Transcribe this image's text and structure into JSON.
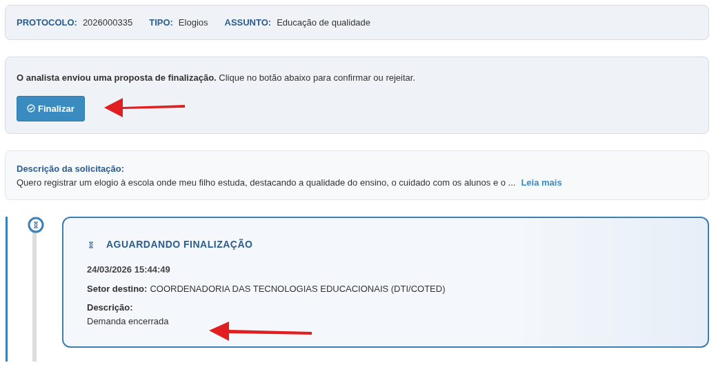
{
  "header_fields": [
    {
      "label": "PROTOCOLO:",
      "value": "2026000335"
    },
    {
      "label": "TIPO:",
      "value": "Elogios"
    },
    {
      "label": "ASSUNTO:",
      "value": "Educação de qualidade"
    }
  ],
  "proposal": {
    "message": "**O analista enviou uma proposta de finalização.** Clique no botão abaixo para confirmar ou rejeitar.",
    "button": "Finalizar"
  },
  "request": {
    "title": "Descrição da solicitação:",
    "text": "Quero registrar um elogio à escola onde meu filho estuda, destacando a qualidade do ensino, o cuidado com os alunos e o ...",
    "link": "Leia mais"
  },
  "timeline": [
    {
      "status": "AGUARDANDO FINALIZAÇÃO",
      "datetime": "24/03/2026 15:44:49",
      "sector_label": "Setor destino:",
      "sector": "COORDENADORIA DAS TECNOLOGIAS EDUCACIONAIS (DTI/COTED)",
      "description_label": "Descrição:",
      "description": "Demanda encerrada"
    }
  ]
}
